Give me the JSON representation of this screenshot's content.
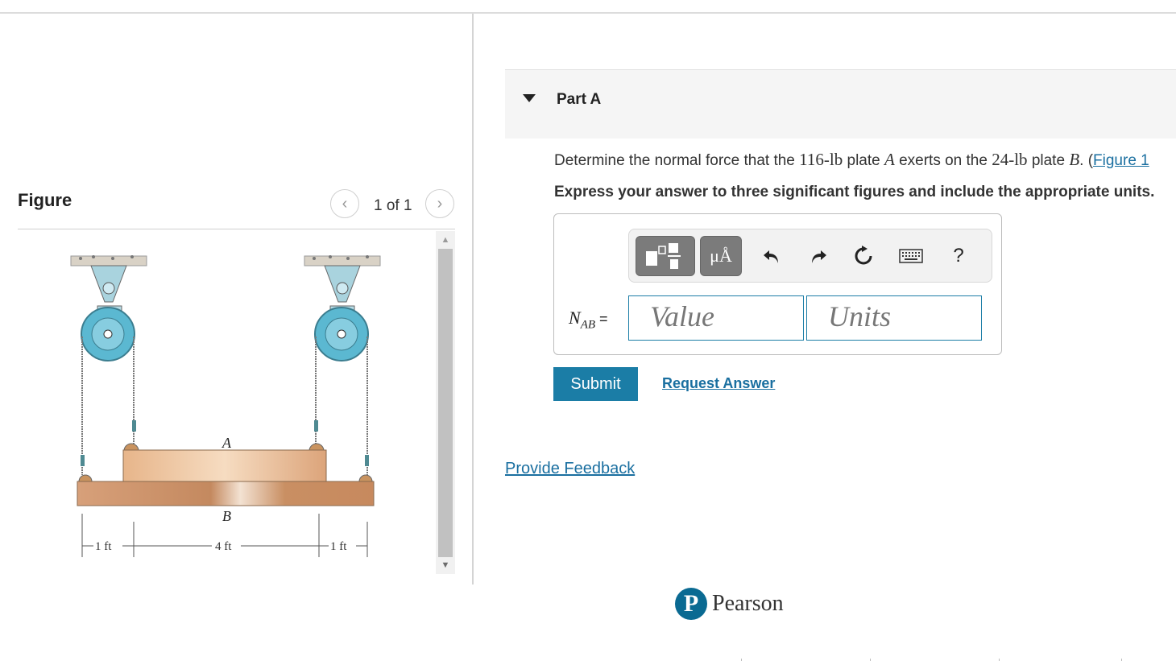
{
  "figure_panel": {
    "title": "Figure",
    "pager_text": "1 of 1",
    "prev_icon": "chevron-left-icon",
    "next_icon": "chevron-right-icon",
    "diagram_labels": {
      "plate_a": "A",
      "plate_b": "B",
      "dim_left": "1 ft",
      "dim_middle": "4 ft",
      "dim_right": "1 ft"
    }
  },
  "part": {
    "title": "Part A",
    "question": {
      "before": "Determine the normal force that the ",
      "weight_a": "116-lb",
      "mid1": " plate ",
      "plate_a": "A",
      "mid2": " exerts on the ",
      "weight_b": "24-lb",
      "mid3": " plate ",
      "plate_b": "B",
      "after": ". (",
      "figure_link": "Figure 1"
    },
    "instruction": "Express your answer to three significant figures and include the appropriate units."
  },
  "answer": {
    "label_main": "N",
    "label_sub": "AB",
    "label_eq": " =",
    "value_placeholder": "Value",
    "units_placeholder": "Units",
    "toolbar": {
      "templates_icon": "templates-icon",
      "units_button": "μÅ",
      "undo_icon": "undo-icon",
      "redo_icon": "redo-icon",
      "reset_icon": "reset-icon",
      "keyboard_icon": "keyboard-icon",
      "help": "?"
    }
  },
  "actions": {
    "submit": "Submit",
    "request_answer": "Request Answer",
    "provide_feedback": "Provide Feedback"
  },
  "branding": {
    "logo_mark": "P",
    "logo_text": "Pearson",
    "brand_color": "#0a6a92",
    "link_color": "#1a6fa0",
    "button_color": "#1b7da6"
  }
}
